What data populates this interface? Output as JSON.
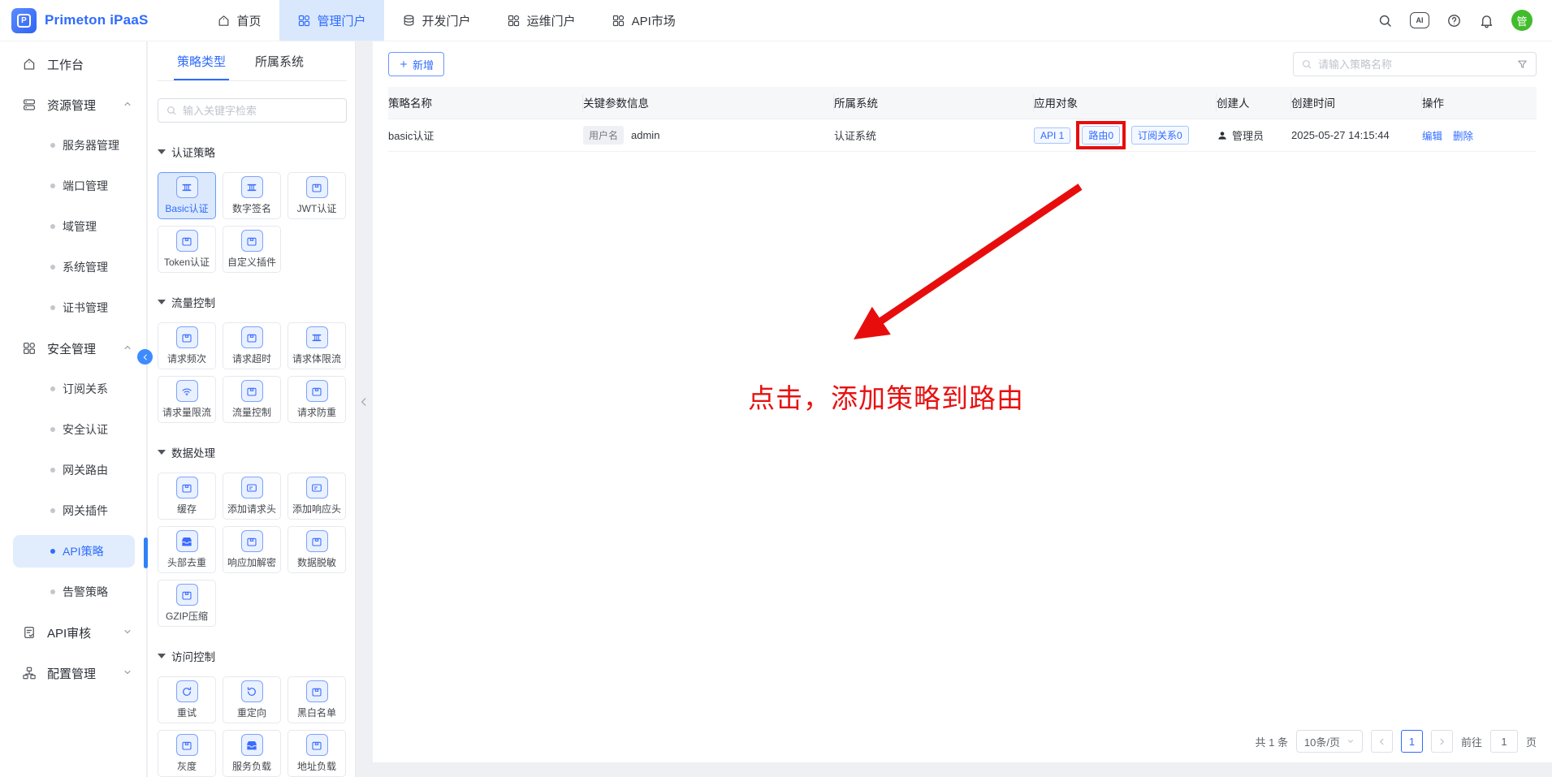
{
  "header": {
    "brand": "Primeton iPaaS",
    "ai_label": "AI",
    "avatar": "管",
    "nav": [
      {
        "label": "首页"
      },
      {
        "label": "管理门户"
      },
      {
        "label": "开发门户"
      },
      {
        "label": "运维门户"
      },
      {
        "label": "API市场"
      }
    ]
  },
  "sidebar": {
    "workbench": "工作台",
    "groups": [
      {
        "label": "资源管理",
        "children": [
          "服务器管理",
          "端口管理",
          "域管理",
          "系统管理",
          "证书管理"
        ]
      },
      {
        "label": "安全管理",
        "children": [
          "订阅关系",
          "安全认证",
          "网关路由",
          "网关插件",
          "API策略",
          "告警策略"
        ]
      },
      {
        "label": "API审核"
      },
      {
        "label": "配置管理"
      }
    ]
  },
  "panel": {
    "tabs": [
      {
        "label": "策略类型"
      },
      {
        "label": "所属系统"
      }
    ],
    "search_placeholder": "输入关键字检索",
    "sections": [
      {
        "title": "认证策略",
        "cards": [
          {
            "label": "Basic认证"
          },
          {
            "label": "数字签名"
          },
          {
            "label": "JWT认证"
          },
          {
            "label": "Token认证"
          },
          {
            "label": "自定义插件"
          }
        ]
      },
      {
        "title": "流量控制",
        "cards": [
          {
            "label": "请求频次"
          },
          {
            "label": "请求超时"
          },
          {
            "label": "请求体限流"
          },
          {
            "label": "请求量限流"
          },
          {
            "label": "流量控制"
          },
          {
            "label": "请求防重"
          }
        ]
      },
      {
        "title": "数据处理",
        "cards": [
          {
            "label": "缓存"
          },
          {
            "label": "添加请求头"
          },
          {
            "label": "添加响应头"
          },
          {
            "label": "头部去重"
          },
          {
            "label": "响应加解密"
          },
          {
            "label": "数据脱敏"
          },
          {
            "label": "GZIP压缩"
          }
        ]
      },
      {
        "title": "访问控制",
        "cards": [
          {
            "label": "重试"
          },
          {
            "label": "重定向"
          },
          {
            "label": "黑白名单"
          },
          {
            "label": "灰度"
          },
          {
            "label": "服务负载"
          },
          {
            "label": "地址负载"
          }
        ]
      }
    ]
  },
  "main": {
    "add_label": "新增",
    "search_placeholder": "请输入策略名称",
    "columns": [
      "策略名称",
      "关键参数信息",
      "所属系统",
      "应用对象",
      "创建人",
      "创建时间",
      "操作"
    ],
    "row": {
      "name": "basic认证",
      "param_key": "用户名",
      "param_value": "admin",
      "system": "认证系统",
      "targets": [
        "API 1",
        "路由0",
        "订阅关系0"
      ],
      "creator": "管理员",
      "created_at": "2025-05-27 14:15:44",
      "edit": "编辑",
      "delete": "删除"
    },
    "pagination": {
      "total": "共 1 条",
      "page_size": "10条/页",
      "current_page": "1",
      "goto": "前往",
      "goto_value": "1",
      "unit": "页"
    }
  },
  "annotation": {
    "text": "点击，添加策略到路由"
  },
  "colors": {
    "primary": "#2f6bff",
    "annotation_red": "#e81111",
    "avatar_green": "#42bc2d"
  }
}
